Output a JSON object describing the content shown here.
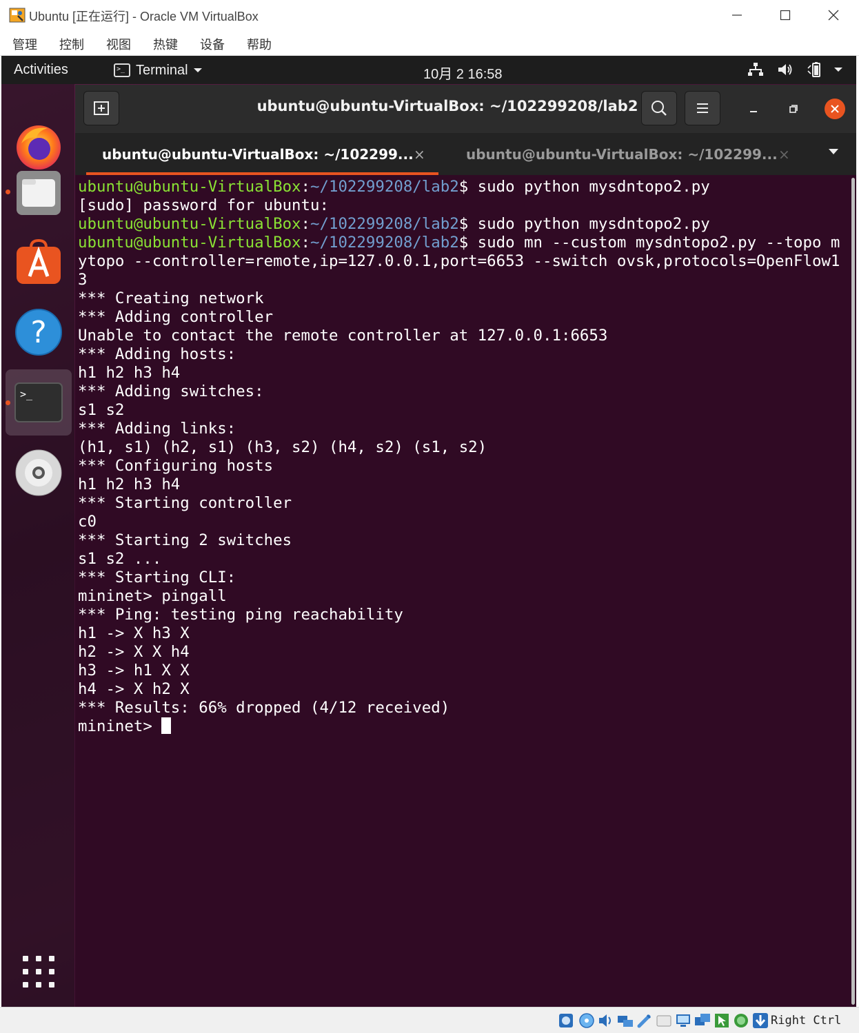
{
  "vbox": {
    "title": "Ubuntu [正在运行] - Oracle VM VirtualBox",
    "menu": [
      "管理",
      "控制",
      "视图",
      "热键",
      "设备",
      "帮助"
    ],
    "host_key": "Right Ctrl"
  },
  "gnome": {
    "activities": "Activities",
    "app_menu": "Terminal",
    "clock": "10月 2  16:58"
  },
  "terminal": {
    "window_title": "ubuntu@ubuntu-VirtualBox: ~/102299208/lab2",
    "tabs": [
      {
        "label": "ubuntu@ubuntu-VirtualBox: ~/102299...",
        "active": true
      },
      {
        "label": "ubuntu@ubuntu-VirtualBox: ~/102299...",
        "active": false
      }
    ],
    "prompt_user": "ubuntu@ubuntu-VirtualBox",
    "prompt_path": "~/102299208/lab2",
    "lines": [
      {
        "user": "ubuntu@ubuntu-VirtualBox",
        "path": "~/102299208/lab2",
        "cmd": "$ sudo python mysdntopo2.py"
      },
      {
        "text": "[sudo] password for ubuntu:"
      },
      {
        "user": "ubuntu@ubuntu-VirtualBox",
        "path": "~/102299208/lab2",
        "cmd": "$ sudo python mysdntopo2.py"
      },
      {
        "user": "ubuntu@ubuntu-VirtualBox",
        "path": "~/102299208/lab2",
        "cmd": "$ sudo mn --custom mysdntopo2.py --topo m"
      },
      {
        "text": "ytopo --controller=remote,ip=127.0.0.1,port=6653 --switch ovsk,protocols=OpenFlow1"
      },
      {
        "text": "3"
      },
      {
        "text": "*** Creating network"
      },
      {
        "text": "*** Adding controller"
      },
      {
        "text": "Unable to contact the remote controller at 127.0.0.1:6653"
      },
      {
        "text": "*** Adding hosts:"
      },
      {
        "text": "h1 h2 h3 h4"
      },
      {
        "text": "*** Adding switches:"
      },
      {
        "text": "s1 s2"
      },
      {
        "text": "*** Adding links:"
      },
      {
        "text": "(h1, s1) (h2, s1) (h3, s2) (h4, s2) (s1, s2)"
      },
      {
        "text": "*** Configuring hosts"
      },
      {
        "text": "h1 h2 h3 h4"
      },
      {
        "text": "*** Starting controller"
      },
      {
        "text": "c0"
      },
      {
        "text": "*** Starting 2 switches"
      },
      {
        "text": "s1 s2 ..."
      },
      {
        "text": "*** Starting CLI:"
      },
      {
        "text": "mininet> pingall"
      },
      {
        "text": "*** Ping: testing ping reachability"
      },
      {
        "text": "h1 -> X h3 X"
      },
      {
        "text": "h2 -> X X h4"
      },
      {
        "text": "h3 -> h1 X X"
      },
      {
        "text": "h4 -> X h2 X"
      },
      {
        "text": "*** Results: 66% dropped (4/12 received)"
      },
      {
        "text": "mininet> ",
        "cursor": true
      }
    ]
  },
  "colors": {
    "terminal_bg": "#300a24",
    "prompt_user": "#8ae234",
    "prompt_path": "#729fcf",
    "accent": "#e95420"
  },
  "icons": {
    "dock": [
      "firefox-icon",
      "files-icon",
      "software-center-icon",
      "help-icon",
      "terminal-icon",
      "dvd-icon",
      "app-grid-icon"
    ],
    "tray": [
      "network-icon",
      "volume-icon",
      "battery-icon",
      "system-menu-chevron-icon"
    ],
    "statusbar": [
      "hard-disk-icon",
      "optical-drive-icon",
      "audio-icon",
      "network-adapter-icon",
      "usb-icon",
      "shared-folder-icon",
      "display-icon",
      "video-capture-icon",
      "mouse-integration-icon",
      "cpu-activity-icon",
      "recording-icon",
      "arrow-down-icon"
    ]
  }
}
